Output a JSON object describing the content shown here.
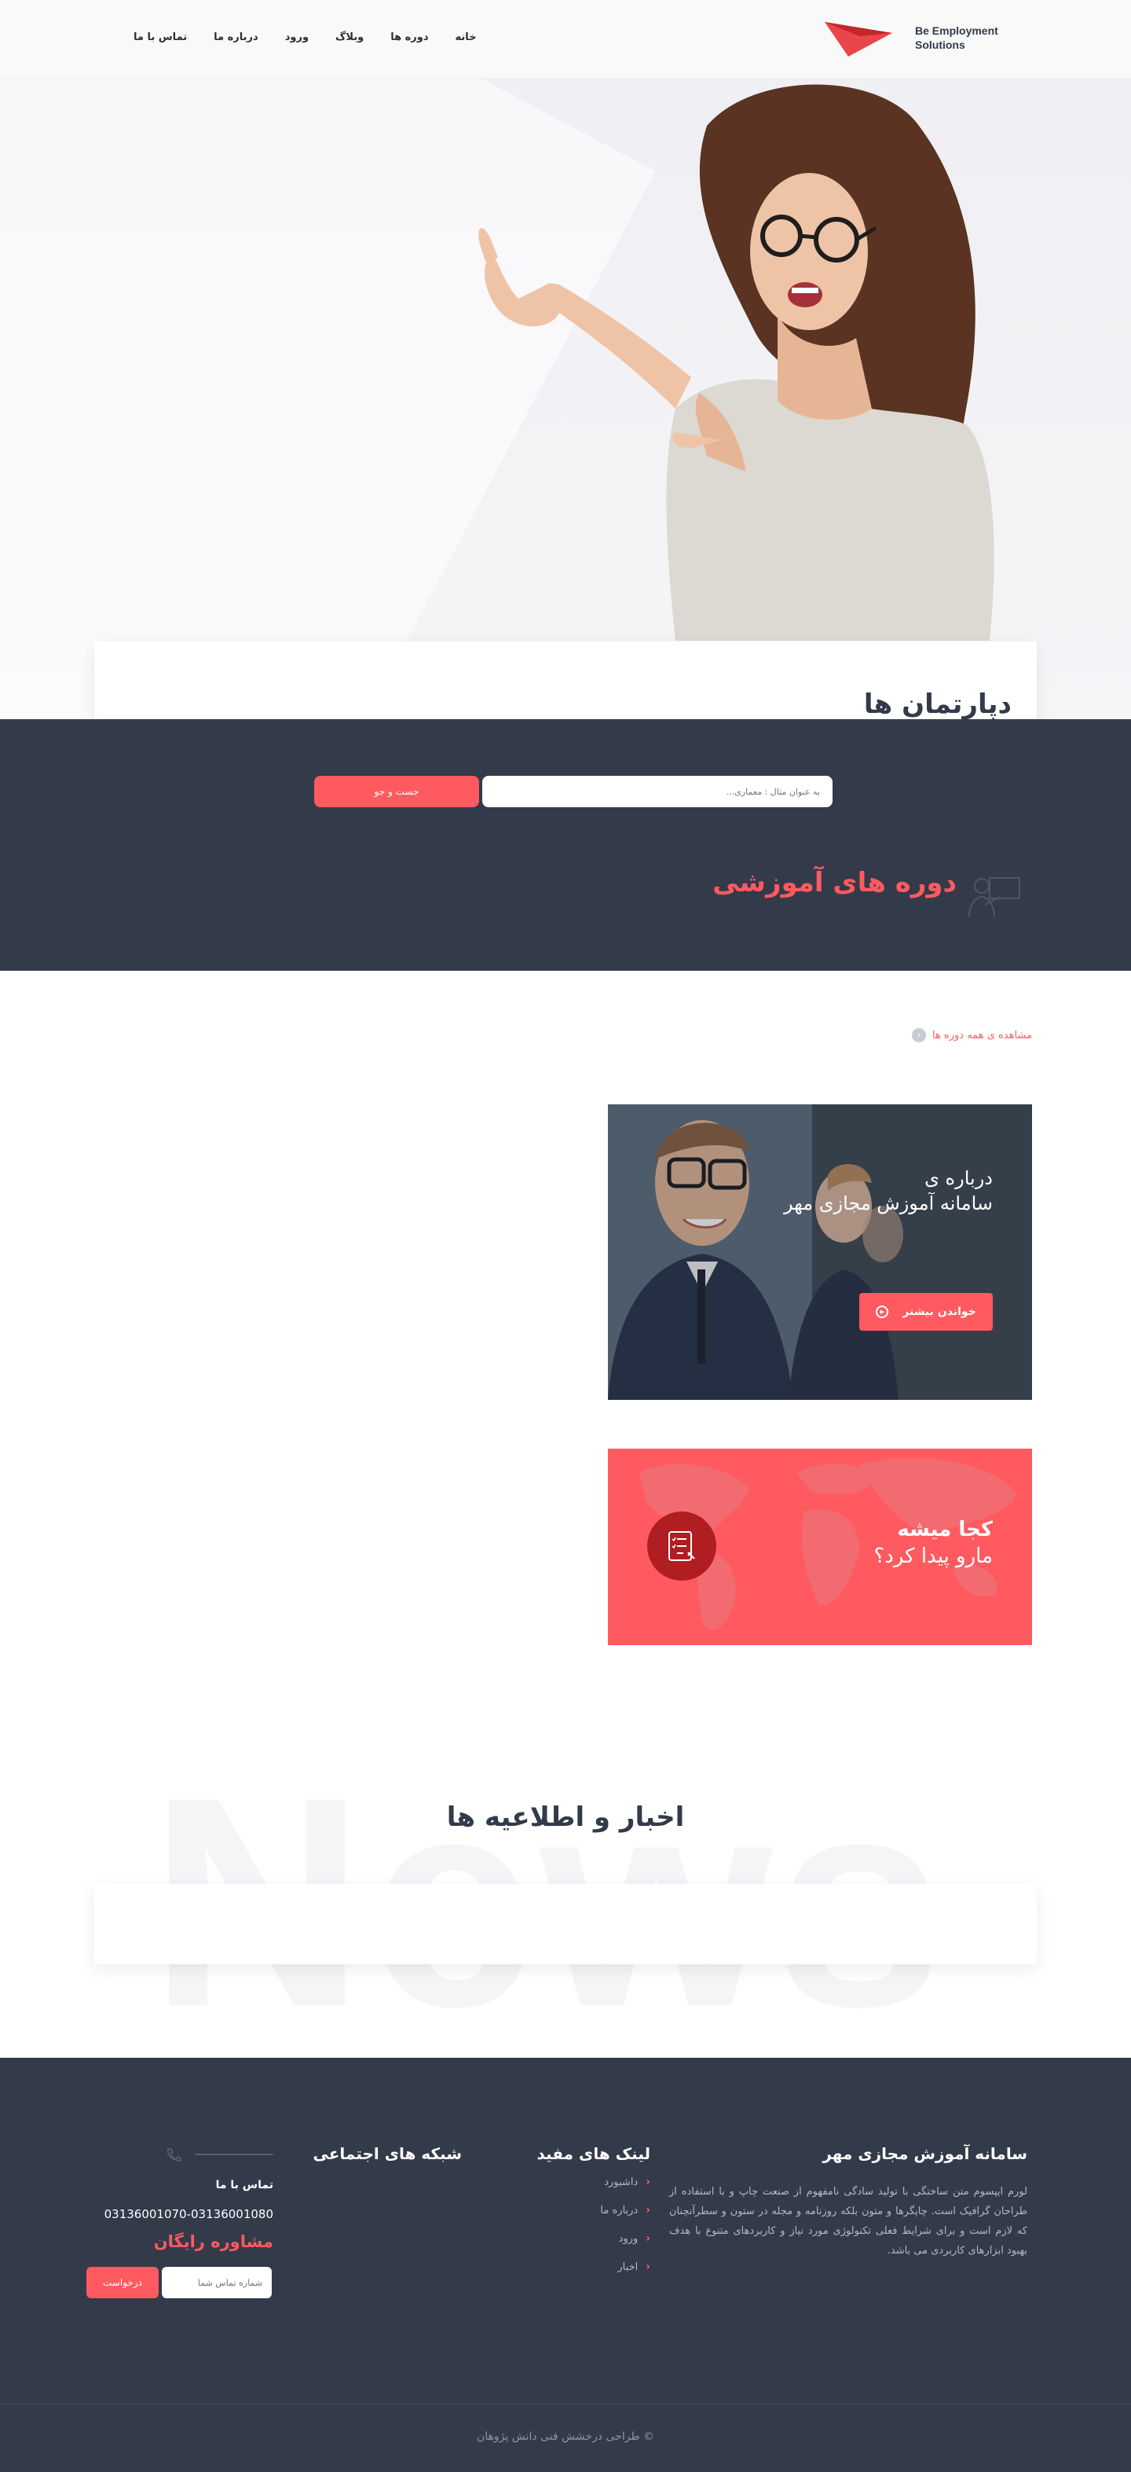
{
  "header": {
    "logo_line1": "Be Employment",
    "logo_line2": "Solutions",
    "nav": [
      "خانه",
      "دوره ها",
      "وبلاگ",
      "ورود",
      "درباره ما",
      "تماس با ما"
    ]
  },
  "hero": {
    "page_title": "دپارتمان ها"
  },
  "search": {
    "placeholder": "به عنوان مثال : معماری...",
    "button": "جست و جو"
  },
  "courses": {
    "title": "دوره های آموزشی",
    "all_link": "مشاهده ی همه دوره ها"
  },
  "about_card": {
    "subtitle": "درباره ی",
    "title": "سامانه آموزش مجازی مهر",
    "button": "خواندن بیشتر"
  },
  "where_card": {
    "title": "کجا میشه",
    "subtitle": "مارو پیدا کرد؟"
  },
  "news": {
    "watermark": "News",
    "title": "اخبار و اطلاعیه ها"
  },
  "footer": {
    "about_title": "سامانه آموزش مجازی مهر",
    "about_text": "لورم ایپسوم متن ساختگی با تولید سادگی نامفهوم از صنعت چاپ و با استفاده از طراحان گرافیک است. چاپگرها و متون بلکه روزنامه و مجله در ستون و سطرآنچنان که لازم است و برای شرایط فعلی تکنولوژی مورد نیاز و کاربردهای متنوع با هدف بهبود ابزارهای کاربردی می باشد.",
    "links_title": "لینک های مفید",
    "links": [
      "داشبورد",
      "درباره ما",
      "ورود",
      "اخبار"
    ],
    "social_title": "شبکه های اجتماعی",
    "contact_title": "تماس با ما",
    "phone": "03136001070-03136001080",
    "consult_title": "مشاوره رایگان",
    "phone_placeholder": "شماره تماس شما",
    "request_button": "درخواست",
    "copyright": "© طراحی درخشش فنی دانش پژوهان"
  },
  "colors": {
    "accent": "#ff5a5f",
    "dark": "#333a4a"
  }
}
